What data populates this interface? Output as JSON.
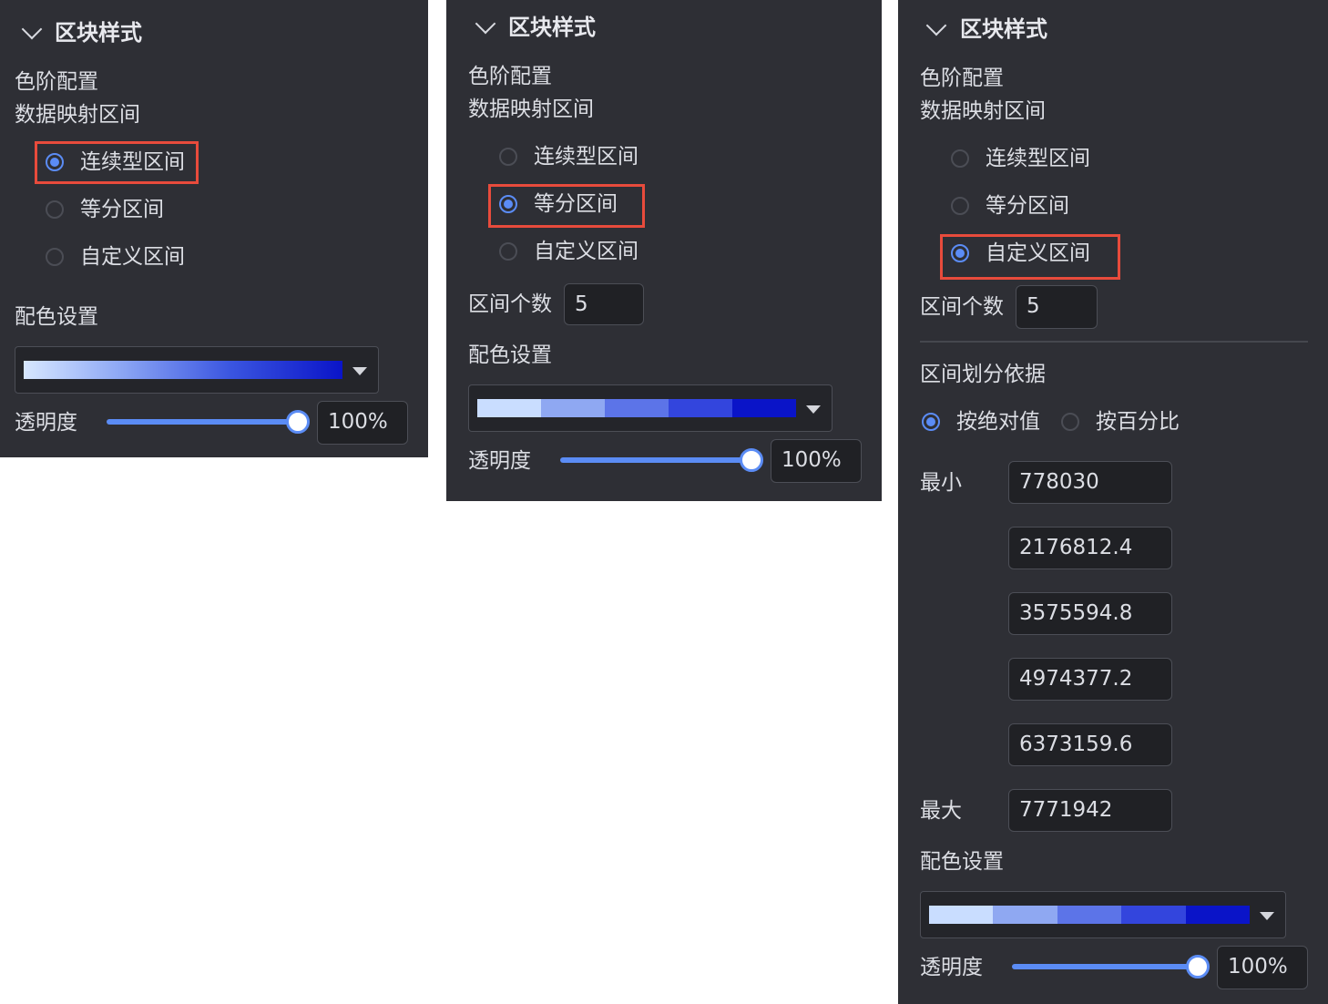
{
  "panel1": {
    "section_title": "区块样式",
    "scale_label": "色阶配置",
    "range_label": "数据映射区间",
    "options": [
      "连续型区间",
      "等分区间",
      "自定义区间"
    ],
    "selected": "连续型区间",
    "color_label": "配色设置",
    "opacity_label": "透明度",
    "opacity_value": "100%",
    "opacity_level": 1.0
  },
  "panel2": {
    "section_title": "区块样式",
    "scale_label": "色阶配置",
    "range_label": "数据映射区间",
    "options": [
      "连续型区间",
      "等分区间",
      "自定义区间"
    ],
    "selected": "等分区间",
    "count_label": "区间个数",
    "count_value": "5",
    "color_label": "配色设置",
    "opacity_label": "透明度",
    "opacity_value": "100%",
    "opacity_level": 1.0
  },
  "panel3": {
    "section_title": "区块样式",
    "scale_label": "色阶配置",
    "range_label": "数据映射区间",
    "options": [
      "连续型区间",
      "等分区间",
      "自定义区间"
    ],
    "selected": "自定义区间",
    "count_label": "区间个数",
    "count_value": "5",
    "basis_label": "区间划分依据",
    "basis_options": [
      "按绝对值",
      "按百分比"
    ],
    "basis_selected": "按绝对值",
    "min_label": "最小",
    "max_label": "最大",
    "breakpoints": [
      "778030",
      "2176812.4",
      "3575594.8",
      "4974377.2",
      "6373159.6",
      "7771942"
    ],
    "color_label": "配色设置",
    "opacity_label": "透明度",
    "opacity_value": "100%",
    "opacity_level": 1.0
  },
  "colors": {
    "panel_bg": "#2e2f35",
    "accent": "#5b8cf5",
    "highlight": "#e84b3c",
    "palette": [
      "#c9ddff",
      "#8fa8f2",
      "#5c74e8",
      "#3345dd",
      "#0a14c8"
    ]
  }
}
